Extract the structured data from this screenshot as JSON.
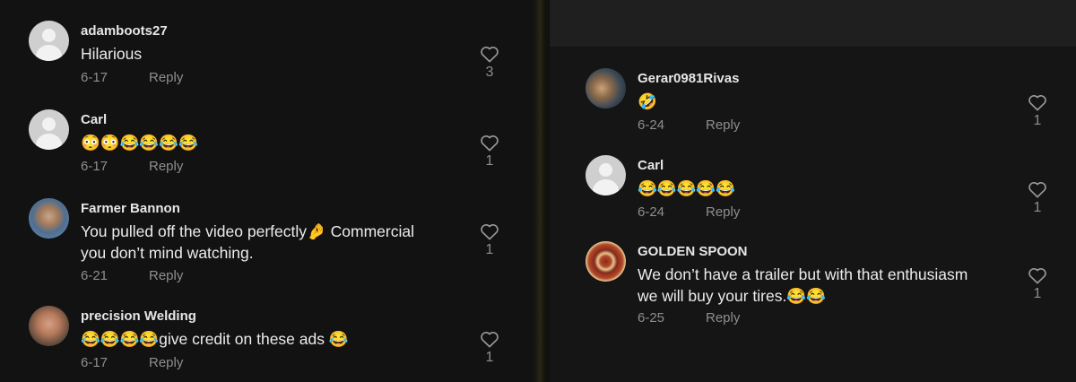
{
  "left_comments": [
    {
      "user": "adamboots27",
      "text": "Hilarious",
      "date": "6-17",
      "reply": "Reply",
      "likes": "3"
    },
    {
      "user": "Carl",
      "text": "😳😳😂😂😂😂",
      "date": "6-17",
      "reply": "Reply",
      "likes": "1"
    },
    {
      "user": "Farmer Bannon",
      "line1": "You pulled off the video perfectly🤌 Commercial",
      "line2": "you don’t mind watching.",
      "date": "6-21",
      "reply": "Reply",
      "likes": "1"
    },
    {
      "user": "precision Welding",
      "text": "😂😂😂😂give credit on these ads 😂",
      "date": "6-17",
      "reply": "Reply",
      "likes": "1"
    }
  ],
  "right_comments": [
    {
      "user": "Gerar0981Rivas",
      "text": "🤣",
      "date": "6-24",
      "reply": "Reply",
      "likes": "1"
    },
    {
      "user": "Carl",
      "text": "😂😂😂😂😂",
      "date": "6-24",
      "reply": "Reply",
      "likes": "1"
    },
    {
      "user": "GOLDEN SPOON",
      "line1": "We don’t have a trailer but with that enthusiasm",
      "line2": "we will buy your tires.😂😂",
      "date": "6-25",
      "reply": "Reply",
      "likes": "1"
    }
  ],
  "icons": {
    "like": "heart-outline-icon",
    "avatar_default": "default-avatar-icon"
  },
  "colors": {
    "background": "#121212",
    "text": "#ececec",
    "muted": "#8e8e8e"
  }
}
